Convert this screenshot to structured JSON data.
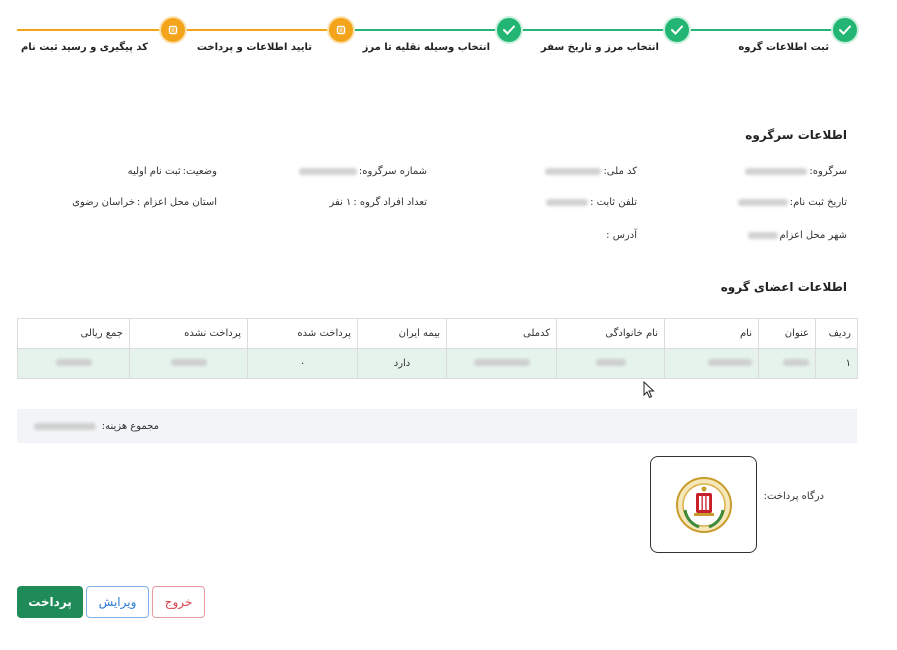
{
  "stepper": {
    "steps": [
      {
        "label": "ثبت اطلاعات گروه",
        "state": "done"
      },
      {
        "label": "انتخاب مرز و تاریخ سفر",
        "state": "done"
      },
      {
        "label": "انتخاب وسیله نقلیه تا مرز",
        "state": "done"
      },
      {
        "label": "تایید اطلاعات و پرداخت",
        "state": "current"
      },
      {
        "label": "کد پیگیری و رسید ثبت نام",
        "state": "current"
      }
    ],
    "colors": {
      "done": "#22b573",
      "current": "#f3a41b",
      "line_done": "#22b573",
      "line_pending": "#f3a41b"
    }
  },
  "leader": {
    "title": "اطلاعات سرگروه",
    "name_label": "سرگروه:",
    "national_code_label": "کد ملی:",
    "group_number_label": "شماره سرگروه:",
    "status_label": "وضعیت:",
    "status_value": "ثبت نام اولیه",
    "reg_date_label": "تاریخ ثبت نام:",
    "phone_label": "تلفن ثابت :",
    "member_count_label": "تعداد افراد گروه :",
    "member_count_value": "۱ نفر",
    "province_label": "استان محل اعزام :",
    "province_value": "خراسان رضوی",
    "city_label": "شهر محل اعزام",
    "address_label": "آدرس :"
  },
  "members": {
    "title": "اطلاعات اعضای گروه",
    "columns": [
      "ردیف",
      "عنوان",
      "نام",
      "نام خانوادگی",
      "کدملی",
      "بیمه ایران",
      "پرداخت شده",
      "پرداخت نشده",
      "جمع ریالی"
    ],
    "rows": [
      {
        "index": "۱",
        "insurance": "دارد",
        "paid": "۰"
      }
    ]
  },
  "total": {
    "label": "مجموع هزینه:"
  },
  "gateway": {
    "label": "درگاه پرداخت:",
    "bank_icon": "bank-melli-logo"
  },
  "buttons": {
    "pay": "پرداخت",
    "edit": "ویرایش",
    "exit": "خروج"
  }
}
